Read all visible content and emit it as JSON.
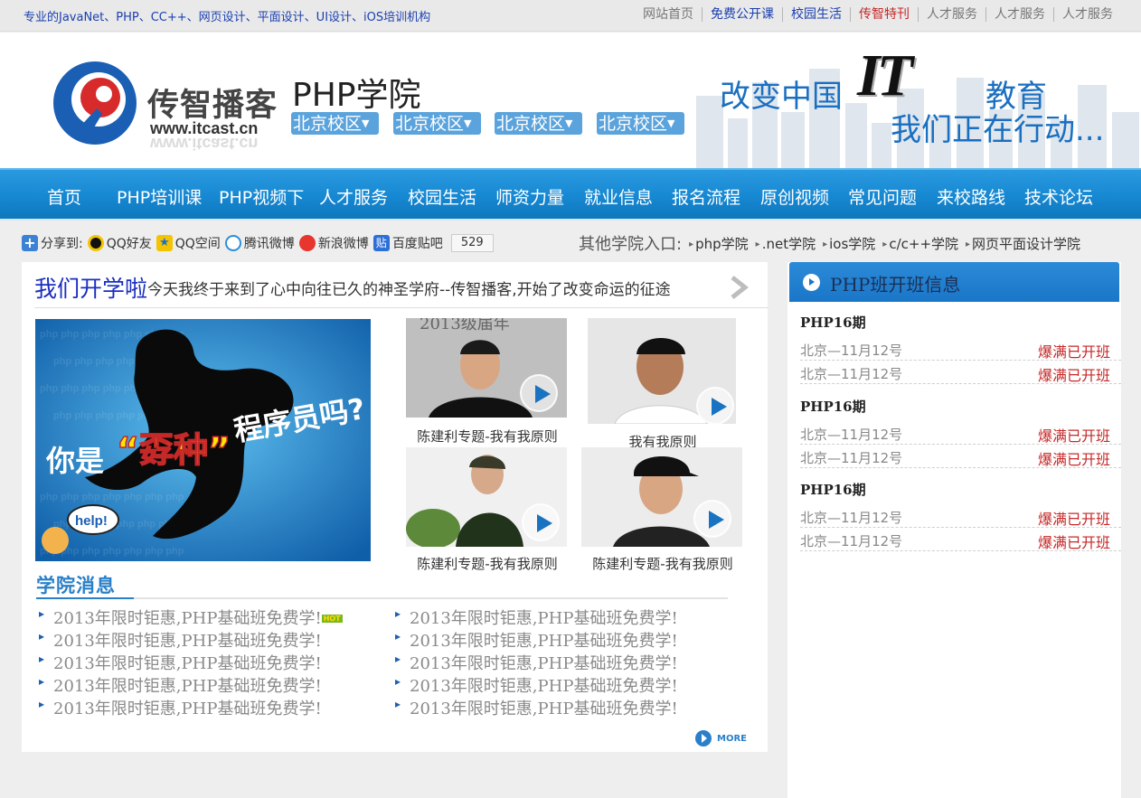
{
  "topbar": {
    "slogan": "专业的JavaNet、PHP、CC++、网页设计、平面设计、UI设计、iOS培训机构",
    "links": [
      "网站首页",
      "免费公开课",
      "校园生活",
      "传智特刊",
      "人才服务",
      "人才服务",
      "人才服务"
    ]
  },
  "header": {
    "logo_cn": "传智播客",
    "logo_url": "www.itcast.cn",
    "college": "PHP学院",
    "campus": [
      "北京校区",
      "北京校区",
      "北京校区",
      "北京校区"
    ],
    "slogan_a": "改变中国",
    "slogan_it": "IT",
    "slogan_b": "教育",
    "slogan_c": "我们正在行动..."
  },
  "nav": [
    "首页",
    "PHP培训课",
    "PHP视频下",
    "人才服务",
    "校园生活",
    "师资力量",
    "就业信息",
    "报名流程",
    "原创视频",
    "常见问题",
    "来校路线",
    "技术论坛"
  ],
  "share": {
    "label": "分享到:",
    "items": [
      "QQ好友",
      "QQ空间",
      "腾讯微博",
      "新浪微博",
      "百度贴吧"
    ],
    "count": "529"
  },
  "other": {
    "label": "其他学院入口:",
    "links": [
      "php学院",
      ".net学院",
      "ios学院",
      "c/c++学院",
      "网页平面设计学院"
    ]
  },
  "main": {
    "headline_big": "我们开学啦",
    "headline_sub": "今天我终于来到了心中向往已久的神圣学府--传智播客,开始了改变命运的征途",
    "banner": {
      "line1": "你是",
      "line2": "“孬种”",
      "line3": "程序员吗?",
      "help": "help!"
    },
    "videos": [
      {
        "caption": "陈建利专题-我有我原则"
      },
      {
        "caption": "我有我原则"
      },
      {
        "caption": "陈建利专题-我有我原则"
      },
      {
        "caption": "陈建利专题-我有我原则"
      }
    ],
    "video_bg_text": "2013级届年",
    "news_title": "学院消息",
    "news_left": [
      "2013年限时钜惠,PHP基础班免费学!",
      "2013年限时钜惠,PHP基础班免费学!",
      "2013年限时钜惠,PHP基础班免费学!",
      "2013年限时钜惠,PHP基础班免费学!",
      "2013年限时钜惠,PHP基础班免费学!"
    ],
    "news_right": [
      "2013年限时钜惠,PHP基础班免费学!",
      "2013年限时钜惠,PHP基础班免费学!",
      "2013年限时钜惠,PHP基础班免费学!",
      "2013年限时钜惠,PHP基础班免费学!",
      "2013年限时钜惠,PHP基础班免费学!"
    ],
    "hot_badge": "HOT",
    "more": "MORE"
  },
  "side": {
    "title": "PHP班开班信息",
    "groups": [
      {
        "term": "PHP16期",
        "rows": [
          {
            "left": "北京—11月12号",
            "right": "爆满已开班"
          },
          {
            "left": "北京—11月12号",
            "right": "爆满已开班"
          }
        ]
      },
      {
        "term": "PHP16期",
        "rows": [
          {
            "left": "北京—11月12号",
            "right": "爆满已开班"
          },
          {
            "left": "北京—11月12号",
            "right": "爆满已开班"
          }
        ]
      },
      {
        "term": "PHP16期",
        "rows": [
          {
            "left": "北京—11月12号",
            "right": "爆满已开班"
          },
          {
            "left": "北京—11月12号",
            "right": "爆满已开班"
          }
        ]
      }
    ]
  },
  "colors": {
    "nav_blue": "#1688d2",
    "link_blue": "#1a3fb0",
    "accent_red": "#c62828",
    "side_head_blue": "#1a76c8"
  },
  "icons": [
    "plus-share-icon",
    "qq-icon",
    "qzone-icon",
    "tencent-weibo-icon",
    "sina-weibo-icon",
    "baidu-tieba-icon",
    "play-icon",
    "chevron-right-icon",
    "more-arrow-icon"
  ]
}
